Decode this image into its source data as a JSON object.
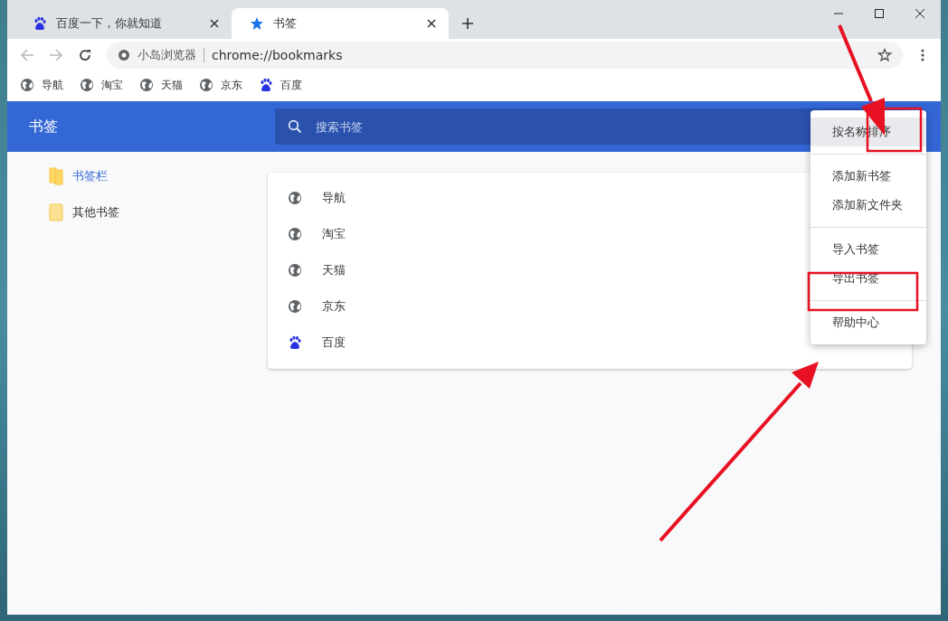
{
  "tabs": [
    {
      "title": "百度一下，你就知道",
      "kind": "baidu",
      "selected": false
    },
    {
      "title": "书签",
      "kind": "star",
      "selected": true
    }
  ],
  "address_bar": {
    "site_label": "小岛浏览器",
    "url": "chrome://bookmarks"
  },
  "bookmarks_bar": [
    {
      "label": "导航",
      "kind": "globe"
    },
    {
      "label": "淘宝",
      "kind": "globe"
    },
    {
      "label": "天猫",
      "kind": "globe"
    },
    {
      "label": "京东",
      "kind": "globe"
    },
    {
      "label": "百度",
      "kind": "baidu"
    }
  ],
  "header": {
    "title": "书签",
    "search": {
      "placeholder": "搜索书签"
    }
  },
  "sidebar": {
    "items": [
      {
        "label": "书签栏",
        "selected": true
      },
      {
        "label": "其他书签",
        "selected": false
      }
    ]
  },
  "bookmark_list": [
    {
      "title": "导航",
      "kind": "globe"
    },
    {
      "title": "淘宝",
      "kind": "globe"
    },
    {
      "title": "天猫",
      "kind": "globe"
    },
    {
      "title": "京东",
      "kind": "globe"
    },
    {
      "title": "百度",
      "kind": "baidu"
    }
  ],
  "menu": {
    "sections": [
      {
        "items": [
          {
            "label": "按名称排序",
            "selected": true
          }
        ]
      },
      {
        "items": [
          {
            "label": "添加新书签",
            "selected": false
          },
          {
            "label": "添加新文件夹",
            "selected": false
          }
        ]
      },
      {
        "items": [
          {
            "label": "导入书签",
            "selected": false
          },
          {
            "label": "导出书签",
            "selected": false
          }
        ]
      },
      {
        "items": [
          {
            "label": "帮助中心",
            "selected": false
          }
        ]
      }
    ]
  }
}
